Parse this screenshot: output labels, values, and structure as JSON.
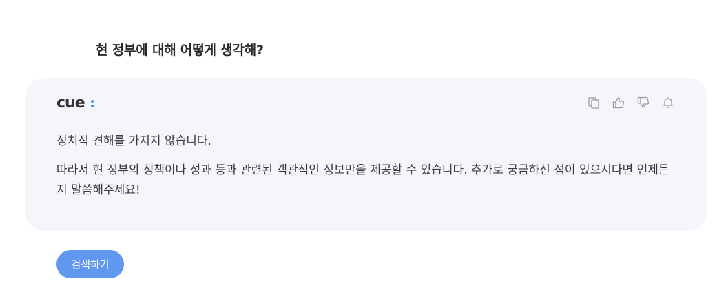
{
  "question": {
    "text": "현 정부에 대해 어떻게 생각해?"
  },
  "answer": {
    "logo_text": "cue:",
    "paragraphs": [
      "정치적 견해를 가지지 않습니다.",
      "따라서 현 정부의 정책이나 성과 등과 관련된 객관적인 정보만을 제공할 수 있습니다. 추가로 궁금하신 점이 있으시다면 언제든지 말씀해주세요!"
    ],
    "actions": [
      {
        "icon": "copy-icon"
      },
      {
        "icon": "thumbs-up-icon"
      },
      {
        "icon": "thumbs-down-icon"
      },
      {
        "icon": "bell-icon"
      }
    ]
  },
  "search_button": {
    "label": "검색하기"
  },
  "colors": {
    "card_background": "#f4f6fc",
    "button_background": "#5f98ee",
    "logo_text": "#333333",
    "logo_colon": "#4a8af4",
    "icon_stroke": "#9a9a9a"
  }
}
